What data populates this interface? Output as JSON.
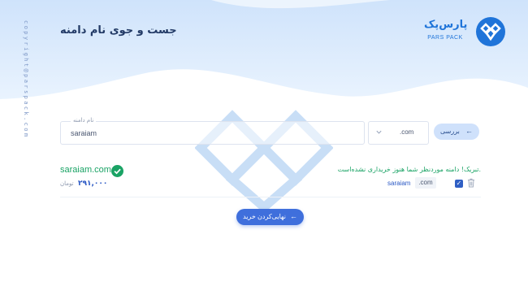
{
  "sidebar": {
    "vertical_text": "copyright@parspack.com"
  },
  "header": {
    "page_title": "جست و جوی نام دامنه",
    "logo_text_fa": "پارس‌پک",
    "logo_text_en": "PARS PACK"
  },
  "search": {
    "domain_label": "نام دامنه",
    "domain_value": "saraiam",
    "tld_value": ".com",
    "check_button": "بررسی"
  },
  "result": {
    "domain": "saraiam.com",
    "status": "available",
    "price": "۲۹۱,۰۰۰",
    "currency": "تومان",
    "message": "تبریک! دامنه موردنظر شما هنوز خریداری نشده‌است.",
    "name": "saraiam",
    "tld": ".com",
    "selected": true
  },
  "actions": {
    "finalize_button": "نهایی‌کردن خرید"
  },
  "colors": {
    "brand_blue": "#1f74d9",
    "accent_blue": "#3f6fdc",
    "success_green": "#1aa365",
    "title_navy": "#223a66"
  }
}
